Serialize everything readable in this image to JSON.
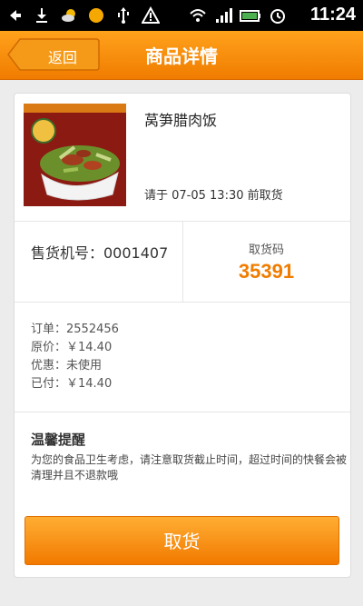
{
  "status_bar": {
    "time": "11:24",
    "icons": [
      "back-arrow-icon",
      "download-icon",
      "weather-icon",
      "sun-icon",
      "usb-icon",
      "warning-icon",
      "wifi-icon",
      "signal-icon",
      "battery-icon",
      "alarm-icon"
    ]
  },
  "header": {
    "back_label": "返回",
    "title": "商品详情"
  },
  "product": {
    "name": "莴笋腊肉饭",
    "pickup_time": "请于 07-05 13:30 前取货"
  },
  "machine": {
    "number_text": "售货机号：0001407",
    "code_label": "取货码",
    "code_value": "35391"
  },
  "order_info": {
    "order": "订单：2552456",
    "original_price": "原价：￥14.40",
    "discount": "优惠：未使用",
    "paid": "已付：￥14.40"
  },
  "tip": {
    "title": "温馨提醒",
    "text": "为您的食品卫生考虑，请注意取货截止时间，超过时间的快餐会被清理并且不退款哦"
  },
  "action": {
    "pickup_label": "取货"
  },
  "colors": {
    "accent": "#f07c00",
    "header_top": "#ffa21c",
    "product_bg": "#8b1a12"
  }
}
